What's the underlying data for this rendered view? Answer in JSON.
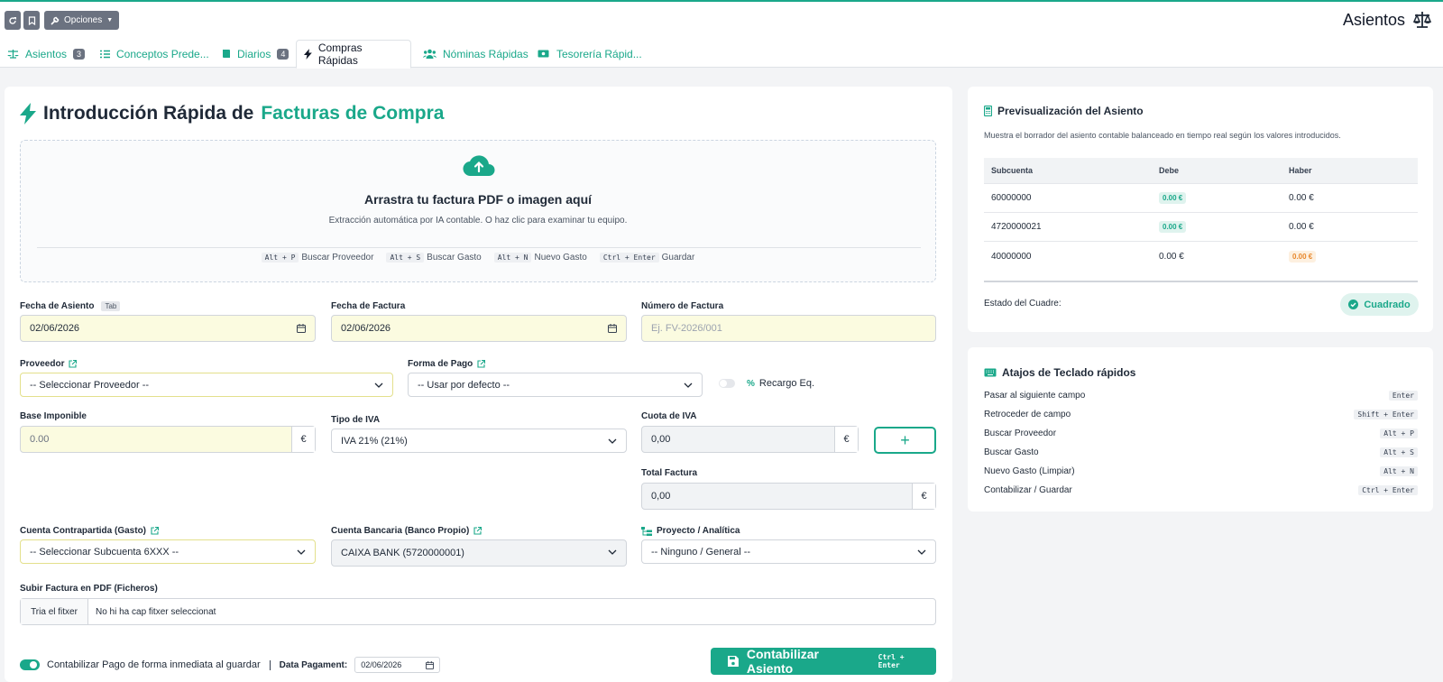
{
  "topbar": {
    "options_label": "Opciones",
    "title": "Asientos"
  },
  "tabs": [
    {
      "label": "Asientos",
      "badge": "3"
    },
    {
      "label": "Conceptos Prede...",
      "badge": ""
    },
    {
      "label": "Diarios",
      "badge": "4"
    },
    {
      "label": "Compras Rápidas",
      "badge": ""
    },
    {
      "label": "Nóminas Rápidas",
      "badge": ""
    },
    {
      "label": "Tesorería Rápid...",
      "badge": ""
    }
  ],
  "main": {
    "title_a": "Introducción Rápida de",
    "title_b": "Facturas de Compra",
    "drop": {
      "title": "Arrastra tu factura PDF o imagen aquí",
      "subtitle": "Extracción automática por IA contable. O haz clic para examinar tu equipo.",
      "shortcuts": [
        {
          "key": "Alt + P",
          "label": "Buscar Proveedor"
        },
        {
          "key": "Alt + S",
          "label": "Buscar Gasto"
        },
        {
          "key": "Alt + N",
          "label": "Nuevo Gasto"
        },
        {
          "key": "Ctrl + Enter",
          "label": "Guardar"
        }
      ]
    },
    "fields": {
      "fecha_asiento": {
        "label": "Fecha de Asiento",
        "tag": "Tab",
        "value": "02/06/2026"
      },
      "fecha_factura": {
        "label": "Fecha de Factura",
        "value": "02/06/2026"
      },
      "numero_factura": {
        "label": "Número de Factura",
        "placeholder": "Ej. FV-2026/001"
      },
      "proveedor": {
        "label": "Proveedor",
        "value": "-- Seleccionar Proveedor --"
      },
      "forma_pago": {
        "label": "Forma de Pago",
        "value": "-- Usar por defecto --"
      },
      "recargo": {
        "label": "Recargo Eq."
      },
      "base": {
        "label": "Base Imponible",
        "value": "0.00",
        "currency": "€"
      },
      "tipo_iva": {
        "label": "Tipo de IVA",
        "value": "IVA 21% (21%)"
      },
      "cuota_iva": {
        "label": "Cuota de IVA",
        "value": "0,00",
        "currency": "€"
      },
      "total": {
        "label": "Total Factura",
        "value": "0,00",
        "currency": "€"
      },
      "contrapartida": {
        "label": "Cuenta Contrapartida (Gasto)",
        "value": "-- Seleccionar Subcuenta 6XXX --"
      },
      "bancaria": {
        "label": "Cuenta Bancaria (Banco Propio)",
        "value": "CAIXA BANK (5720000001)"
      },
      "proyecto": {
        "label": "Proyecto / Analítica",
        "value": "-- Ninguno / General --"
      },
      "subir": {
        "label": "Subir Factura en PDF (Ficheros)",
        "button": "Tria el fitxer",
        "value": "No hi ha cap fitxer seleccionat"
      }
    },
    "plus_label": "+",
    "pago_label": "Contabilizar Pago de forma inmediata al guardar",
    "data_pagament_label": "Data Pagament:",
    "data_pagament_value": "02/06/2026",
    "post_label": "Contabilizar Asiento",
    "post_key": "Ctrl + Enter"
  },
  "preview": {
    "title": "Previsualización del Asiento",
    "description": "Muestra el borrador del asiento contable balanceado en tiempo real según los valores introducidos.",
    "headers": [
      "Subcuenta",
      "Debe",
      "Haber"
    ],
    "rows": [
      {
        "subcuenta": "60000000",
        "debe": "0.00 €",
        "haber": "0.00 €"
      },
      {
        "subcuenta": "4720000021",
        "debe": "0.00 €",
        "haber": "0.00 €"
      },
      {
        "subcuenta": "40000000",
        "debe": "0.00 €",
        "haber": "0.00 €"
      }
    ],
    "estado_label": "Estado del Cuadre:",
    "estado_value": "Cuadrado"
  },
  "shortcuts": {
    "title": "Atajos de Teclado rápidos",
    "items": [
      {
        "label": "Pasar al siguiente campo",
        "key": "Enter"
      },
      {
        "label": "Retroceder de campo",
        "key": "Shift + Enter"
      },
      {
        "label": "Buscar Proveedor",
        "key": "Alt + P"
      },
      {
        "label": "Buscar Gasto",
        "key": "Alt + S"
      },
      {
        "label": "Nuevo Gasto (Limpiar)",
        "key": "Alt + N"
      },
      {
        "label": "Contabilizar / Guardar",
        "key": "Ctrl + Enter"
      }
    ]
  },
  "colors": {
    "accent": "#1aa88a",
    "highlight_input": "#fbfbe0",
    "warning": "#e8882d"
  }
}
